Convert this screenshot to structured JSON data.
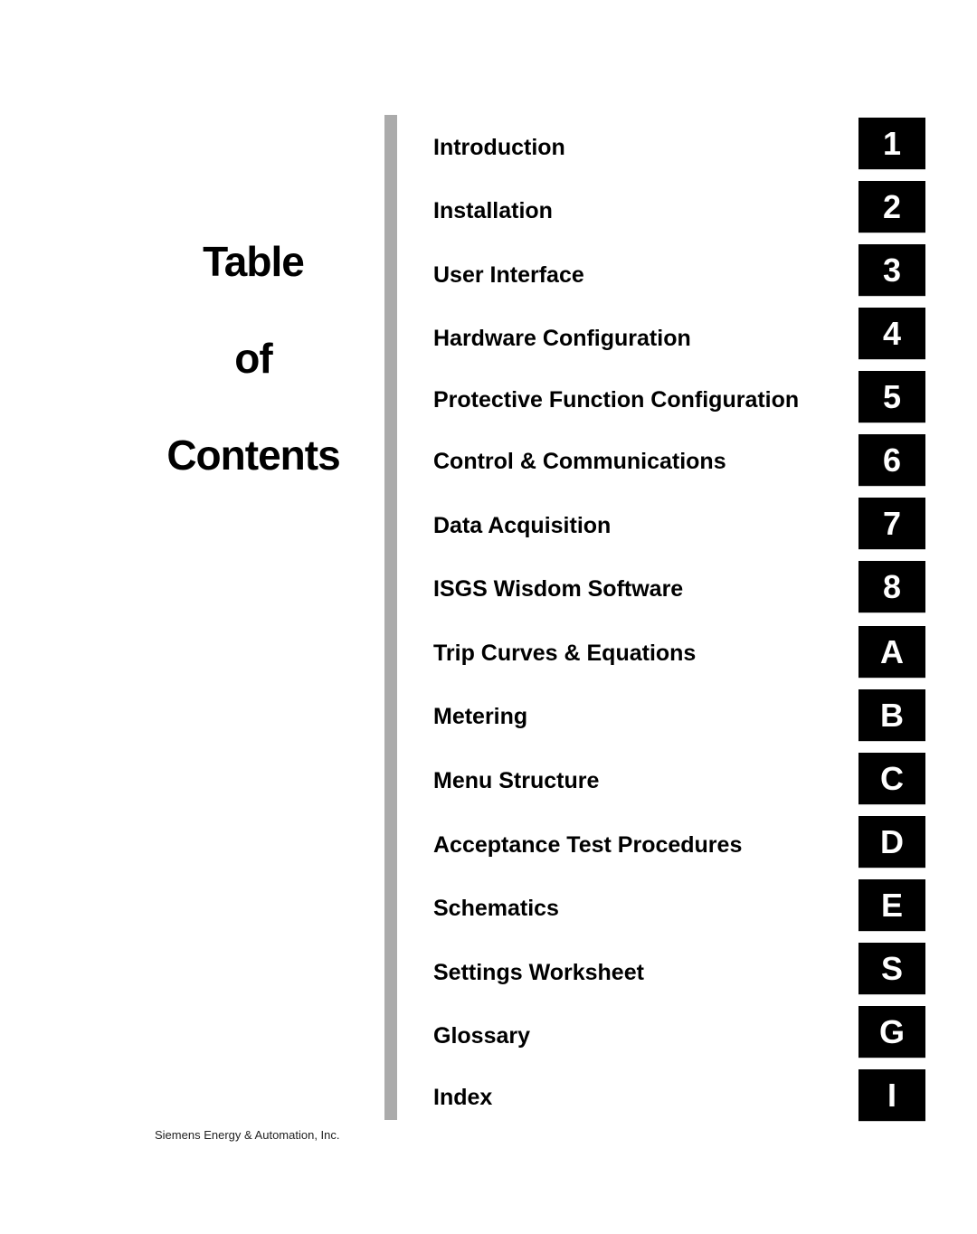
{
  "title": {
    "line1": "Table",
    "line2": "of",
    "line3": "Contents"
  },
  "entries": [
    {
      "label": "Introduction",
      "tab": "1"
    },
    {
      "label": "Installation",
      "tab": "2"
    },
    {
      "label": "User Interface",
      "tab": "3"
    },
    {
      "label": "Hardware Configuration",
      "tab": "4"
    },
    {
      "label": "Protective Function Configuration",
      "tab": "5"
    },
    {
      "label": "Control & Communications",
      "tab": "6"
    },
    {
      "label": "Data Acquisition",
      "tab": "7"
    },
    {
      "label": "ISGS Wisdom Software",
      "tab": "8"
    },
    {
      "label": "Trip Curves & Equations",
      "tab": "A"
    },
    {
      "label": "Metering",
      "tab": "B"
    },
    {
      "label": "Menu Structure",
      "tab": "C"
    },
    {
      "label": "Acceptance Test Procedures",
      "tab": "D"
    },
    {
      "label": "Schematics",
      "tab": "E"
    },
    {
      "label": "Settings Worksheet",
      "tab": "S"
    },
    {
      "label": "Glossary",
      "tab": "G"
    },
    {
      "label": "Index",
      "tab": "I"
    }
  ],
  "footer": "Siemens Energy & Automation, Inc."
}
